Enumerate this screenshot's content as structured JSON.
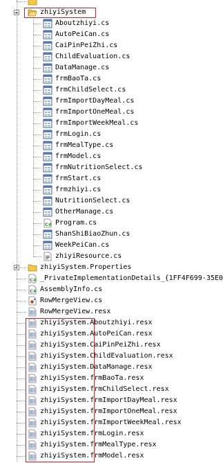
{
  "colors": {
    "highlight_box": "#d21e1e",
    "tree_lines": "#999999"
  },
  "tree": {
    "top_partial": {
      "label": "",
      "icon": "folder-icon"
    },
    "project_folder": {
      "label": "zhiyiSystem",
      "expanded": true,
      "icon": "folder-open-icon"
    },
    "form_files": [
      {
        "label": "Aboutzhiyi.cs",
        "icon": "form-icon"
      },
      {
        "label": "AutoPeiCan.cs",
        "icon": "form-icon"
      },
      {
        "label": "CaiPinPeiZhi.cs",
        "icon": "form-icon"
      },
      {
        "label": "ChildEvaluation.cs",
        "icon": "form-icon"
      },
      {
        "label": "DataManage.cs",
        "icon": "form-icon"
      },
      {
        "label": "frmBaoTa.cs",
        "icon": "form-icon"
      },
      {
        "label": "frmChildSelect.cs",
        "icon": "form-icon"
      },
      {
        "label": "frmImportDayMeal.cs",
        "icon": "form-icon"
      },
      {
        "label": "frmImportOneMeal.cs",
        "icon": "form-icon"
      },
      {
        "label": "frmImportWeekMeal.cs",
        "icon": "form-icon"
      },
      {
        "label": "frmLogin.cs",
        "icon": "form-icon"
      },
      {
        "label": "frmMealType.cs",
        "icon": "form-icon"
      },
      {
        "label": "frmModel.cs",
        "icon": "form-icon"
      },
      {
        "label": "frmNutritionSelect.cs",
        "icon": "form-icon"
      },
      {
        "label": "frmStart.cs",
        "icon": "form-icon"
      },
      {
        "label": "frmzhiyi.cs",
        "icon": "form-icon"
      },
      {
        "label": "NutritionSelect.cs",
        "icon": "form-icon"
      },
      {
        "label": "OtherManage.cs",
        "icon": "form-icon"
      },
      {
        "label": "Program.cs",
        "icon": "csharp-icon"
      },
      {
        "label": "ShanShiBiaoZhun.cs",
        "icon": "form-icon"
      },
      {
        "label": "WeekPeiCan.cs",
        "icon": "form-icon"
      },
      {
        "label": "zhiyiResource.cs",
        "icon": "resource-icon"
      }
    ],
    "properties_folder": {
      "label": "zhiyiSystem.Properties",
      "expanded": false,
      "icon": "folder-icon"
    },
    "other_files": [
      {
        "label": "_PrivateImplementationDetails_{1FF4F699-35E0",
        "icon": "csharp-icon"
      },
      {
        "label": "AssemblyInfo.cs",
        "icon": "csharp-icon"
      },
      {
        "label": "RowMergeView.cs",
        "icon": "component-icon"
      },
      {
        "label": "RowMergeView.resx",
        "icon": "resx-icon"
      }
    ],
    "resx_files": [
      {
        "label": "zhiyiSystem.Aboutzhiyi.resx",
        "icon": "resx-icon"
      },
      {
        "label": "zhiyiSystem.AutoPeiCan.resx",
        "icon": "resx-icon"
      },
      {
        "label": "zhiyiSystem.CaiPinPeiZhi.resx",
        "icon": "resx-icon"
      },
      {
        "label": "zhiyiSystem.ChildEvaluation.resx",
        "icon": "resx-icon"
      },
      {
        "label": "zhiyiSystem.DataManage.resx",
        "icon": "resx-icon"
      },
      {
        "label": "zhiyiSystem.frmBaoTa.resx",
        "icon": "resx-icon"
      },
      {
        "label": "zhiyiSystem.frmChildSelect.resx",
        "icon": "resx-icon"
      },
      {
        "label": "zhiyiSystem.frmImportDayMeal.resx",
        "icon": "resx-icon"
      },
      {
        "label": "zhiyiSystem.frmImportOneMeal.resx",
        "icon": "resx-icon"
      },
      {
        "label": "zhiyiSystem.frmImportWeekMeal.resx",
        "icon": "resx-icon"
      },
      {
        "label": "zhiyiSystem.frmLogin.resx",
        "icon": "resx-icon"
      },
      {
        "label": "zhiyiSystem.frmMealType.resx",
        "icon": "resx-icon"
      },
      {
        "label": "zhiyiSystem.frmModel.resx",
        "icon": "resx-icon"
      }
    ]
  }
}
